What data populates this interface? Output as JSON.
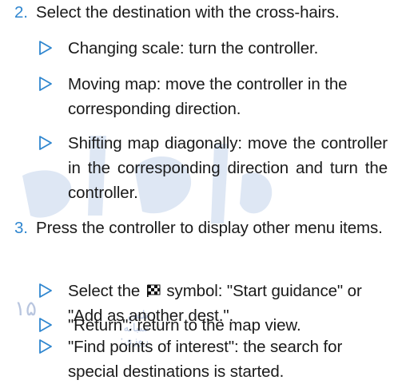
{
  "steps": [
    {
      "number": "2.",
      "text": "Select the destination with the cross-hairs."
    },
    {
      "number": "3.",
      "text": "Press the controller to display other menu items."
    }
  ],
  "step2_bullets": [
    "Changing scale: turn the controller.",
    "Moving map: move the controller in the corresponding direction.",
    "Shifting map diagonally: move the controller in the corresponding direction and turn the controller."
  ],
  "step3_bullets": {
    "b1_prefix": "Select the",
    "b1_icon": "checkered-flag-icon",
    "b1_suffix": "symbol: \"Start guidance\" or \"Add as another dest.\".",
    "b2": "\"Return\": return to the map view.",
    "b3": "\"Find points of interest\": the search for special destinations is started."
  },
  "watermark": {
    "text": "تلفن شبانه روزی:",
    "number": "۱۵"
  },
  "colors": {
    "accent": "#2f86cf",
    "text": "#1a1a1a"
  }
}
